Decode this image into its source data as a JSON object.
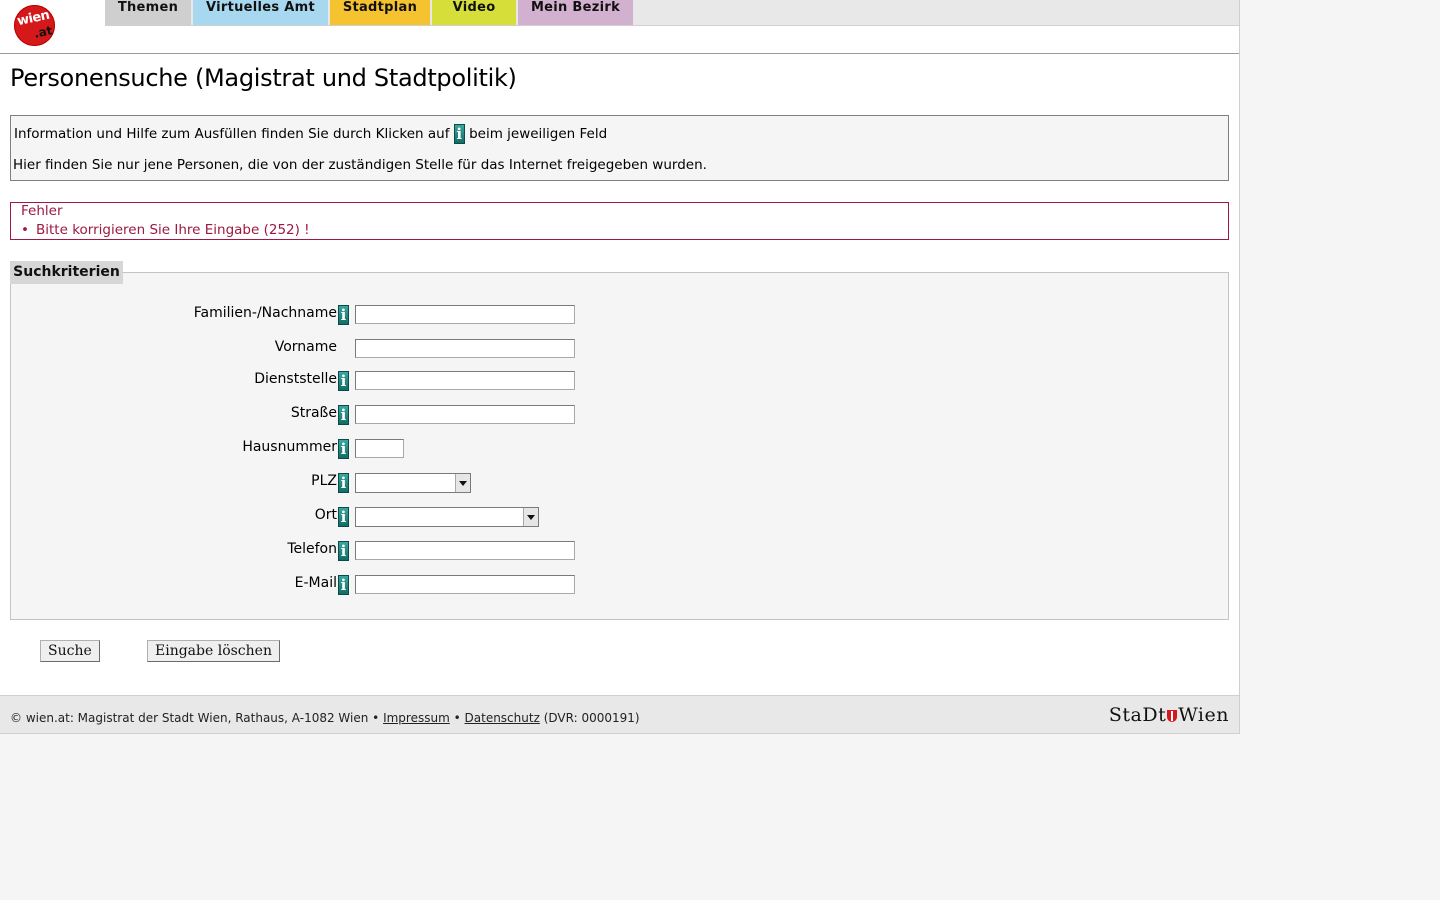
{
  "logo": {
    "line1": "wien",
    "line2": ".at"
  },
  "nav": {
    "tabs": [
      {
        "label": "Themen",
        "color": "#cfcfcf"
      },
      {
        "label": "Virtuelles Amt",
        "color": "#a8d8f0"
      },
      {
        "label": "Stadtplan",
        "color": "#f5c230"
      },
      {
        "label": "Video",
        "color": "#d6df3a"
      },
      {
        "label": "Mein Bezirk",
        "color": "#d1b1cf"
      }
    ]
  },
  "page": {
    "title": "Personensuche (Magistrat und Stadtpolitik)"
  },
  "info": {
    "line1_before": "Information und Hilfe zum Ausfüllen finden Sie durch Klicken auf",
    "info_icon_glyph": "i",
    "line1_after": "beim jeweiligen Feld",
    "line2": "Hier finden Sie nur jene Personen, die von der zuständigen Stelle für das Internet freigegeben wurden."
  },
  "error": {
    "heading": "Fehler",
    "items": [
      "Bitte korrigieren Sie Ihre Eingabe (252) !"
    ],
    "color": "#9d1942"
  },
  "search": {
    "legend": "Suchkriterien",
    "fields": {
      "nachname": {
        "label": "Familien-/Nachname",
        "value": "",
        "has_info": true
      },
      "vorname": {
        "label": "Vorname",
        "value": "",
        "has_info": false
      },
      "dienststelle": {
        "label": "Dienststelle",
        "value": "",
        "has_info": true
      },
      "strasse": {
        "label": "Straße",
        "value": "",
        "has_info": true
      },
      "hausnummer": {
        "label": "Hausnummer",
        "value": "",
        "has_info": true
      },
      "plz": {
        "label": "PLZ",
        "selected": "",
        "has_info": true
      },
      "ort": {
        "label": "Ort",
        "selected": "",
        "has_info": true
      },
      "telefon": {
        "label": "Telefon",
        "value": "",
        "has_info": true
      },
      "email": {
        "label": "E-Mail",
        "value": "",
        "has_info": true
      }
    }
  },
  "buttons": {
    "search": "Suche",
    "clear": "Eingabe löschen"
  },
  "footer": {
    "copyright": "© wien.at: Magistrat der Stadt Wien, Rathaus, A-1082 Wien •",
    "impressum": "Impressum",
    "separator": "•",
    "datenschutz": "Datenschutz",
    "dvr": "(DVR: 0000191)",
    "brand_left": "StaDt",
    "brand_right": "Wien"
  }
}
